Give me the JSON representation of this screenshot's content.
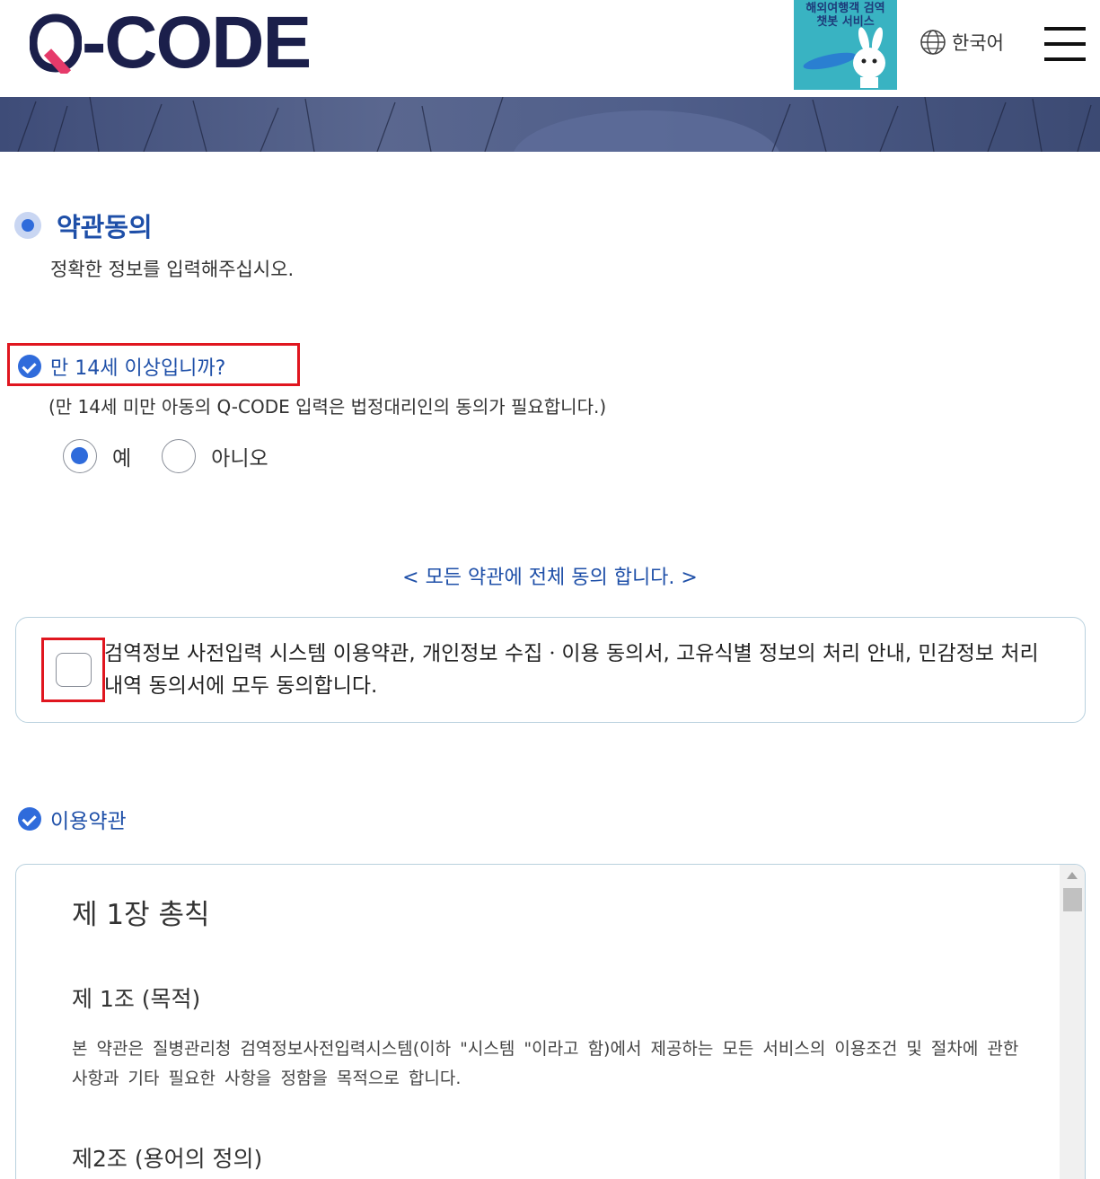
{
  "header": {
    "logo_text": "-CODE",
    "banner_text": "해외여행객 검역\n챗봇 서비스",
    "language": "한국어",
    "brand_color": "#1b1f4b"
  },
  "section": {
    "title": "약관동의",
    "subtitle": "정확한 정보를 입력해주십시오."
  },
  "age_question": {
    "label": "만 14세 이상입니까?",
    "note": "(만 14세 미만 아동의 Q-CODE 입력은 법정대리인의 동의가 필요합니다.)",
    "options": [
      {
        "label": "예",
        "selected": true
      },
      {
        "label": "아니오",
        "selected": false
      }
    ]
  },
  "agree_all": {
    "title": "< 모든 약관에 전체 동의 합니다. >",
    "text": "검역정보 사전입력 시스템 이용약관, 개인정보 수집ㆍ이용 동의서, 고유식별 정보의 처리 안내, 민감정보 처리 내역 동의서에 모두 동의합니다.",
    "checked": false
  },
  "terms": {
    "title": "이용약관",
    "chapter": "제 1장 총칙",
    "article1_title": "제 1조 (목적)",
    "article1_body": "본 약관은 질병관리청 검역정보사전입력시스템(이하 \"시스템 \"이라고 함)에서 제공하는 모든 서비스의 이용조건 및 절차에 관한 사항과 기타 필요한 사항을 정함을 목적으로 합니다.",
    "article2_title": "제2조 (용어의 정의)"
  },
  "colors": {
    "accent": "#2f6bdb",
    "heading_blue": "#1e4fa8",
    "highlight_red": "#e0161f"
  }
}
